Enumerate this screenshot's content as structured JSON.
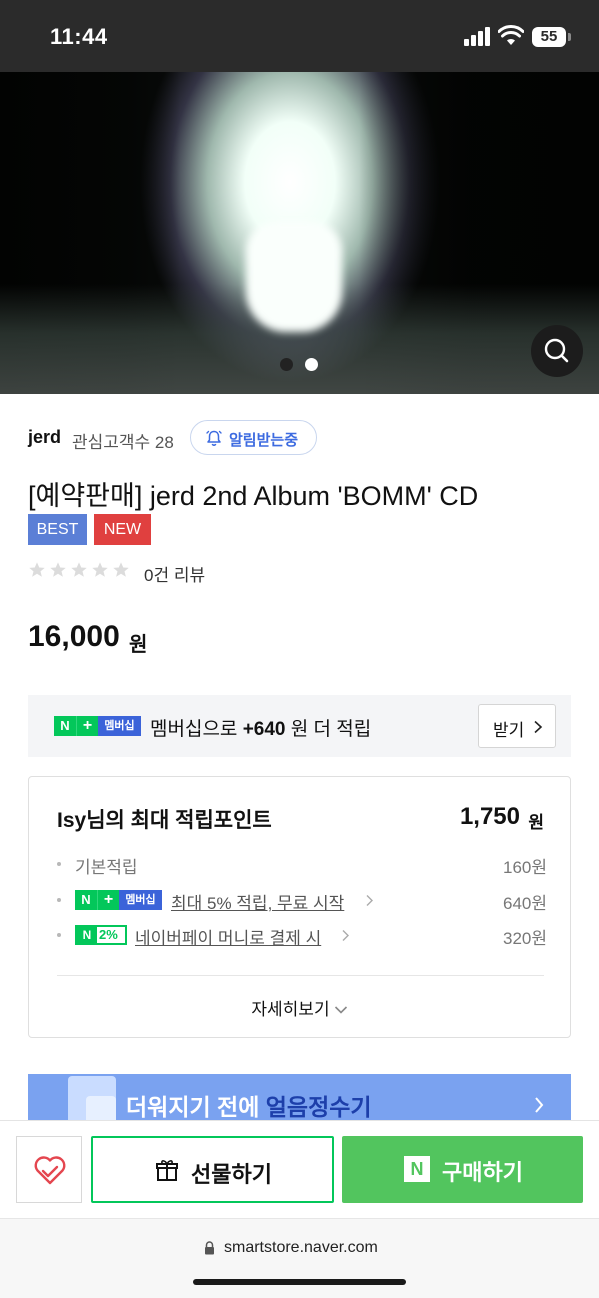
{
  "status_bar": {
    "time": "11:44",
    "battery": "55"
  },
  "hero": {
    "slide_count": 2,
    "active_slide": 1
  },
  "store": {
    "name": "jerd",
    "fans_label": "관심고객수 28",
    "notify_label": "알림받는중"
  },
  "product": {
    "title": "[예약판매] jerd 2nd Album 'BOMM' CD",
    "badges": {
      "best": "BEST",
      "new": "NEW"
    },
    "rating_stars": 0,
    "review_label": "0건 리뷰",
    "price": "16,000",
    "price_unit": "원"
  },
  "membership": {
    "logo_tag": "멤버십",
    "text_prefix": "멤버십으로 ",
    "text_amount": "+640",
    "text_suffix": " 원 더 적립",
    "receive_label": "받기"
  },
  "points": {
    "title": "Isy님의 최대 적립포인트",
    "total": "1,750",
    "total_unit": "원",
    "rows": [
      {
        "label": "기본적립",
        "value": "160원"
      },
      {
        "label": "최대 5% 적립, 무료 시작",
        "value": "640원"
      },
      {
        "label": "네이버페이 머니로 결제 시",
        "value": "320원",
        "logo_text": "2%"
      }
    ],
    "more_label": "자세히보기"
  },
  "banner": {
    "text_prefix": "더워지기 전에 ",
    "text_highlight": "얼음정수기"
  },
  "actions": {
    "gift_label": "선물하기",
    "buy_label": "구매하기"
  },
  "browser": {
    "url": "smartstore.naver.com"
  },
  "colors": {
    "naver_green": "#03c75a",
    "buy_green": "#52c55e",
    "badge_best": "#5b7fd6",
    "badge_new": "#e0403f"
  }
}
